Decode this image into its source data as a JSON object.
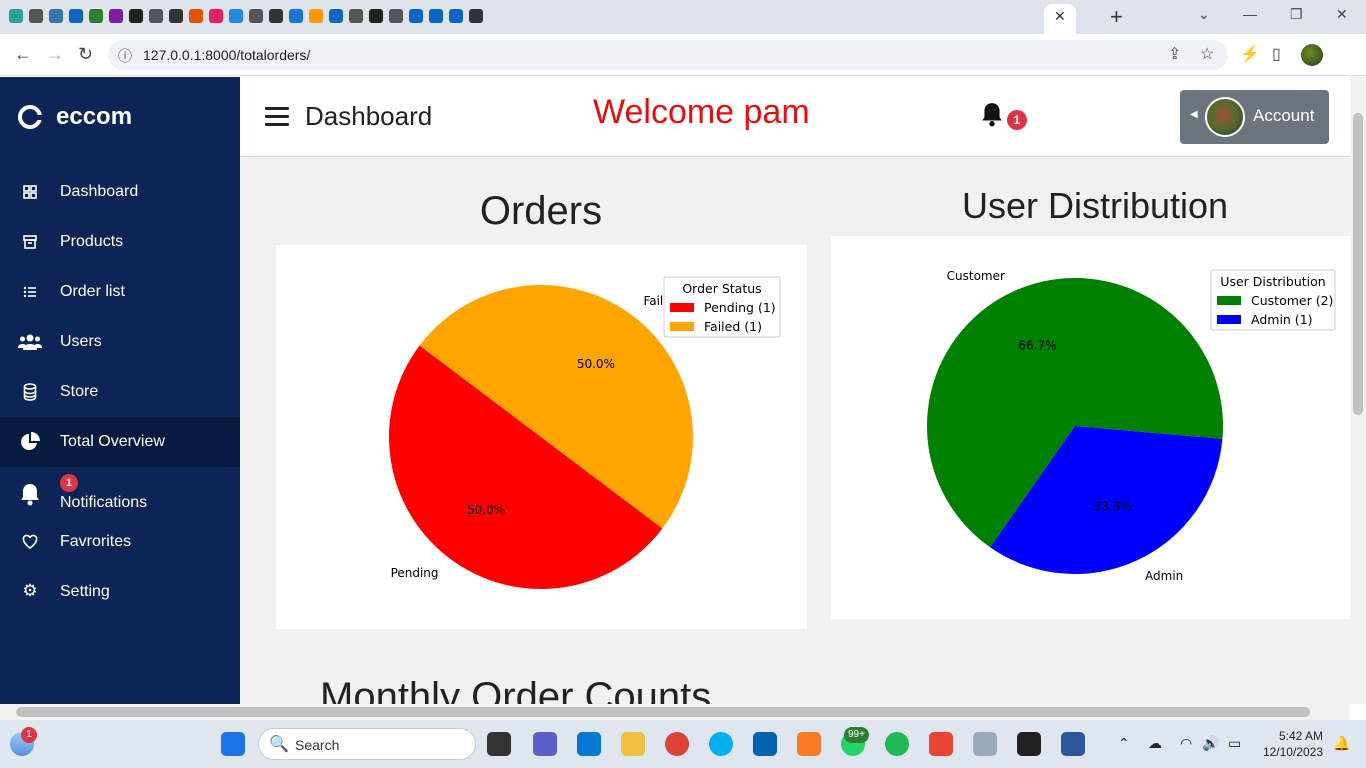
{
  "browser": {
    "url": "127.0.0.1:8000/totalorders/",
    "tab_close": "✕",
    "new_tab": "+"
  },
  "sidebar": {
    "brand": "eccom",
    "items": [
      {
        "label": "Dashboard",
        "icon": "grid-icon"
      },
      {
        "label": "Products",
        "icon": "archive-icon"
      },
      {
        "label": "Order list",
        "icon": "list-icon"
      },
      {
        "label": "Users",
        "icon": "users-icon"
      },
      {
        "label": "Store",
        "icon": "database-icon"
      },
      {
        "label": "Total Overview",
        "icon": "pie-chart-icon"
      },
      {
        "label": "Notifications",
        "icon": "bell-icon",
        "badge": "1"
      },
      {
        "label": "Favrorites",
        "icon": "heart-icon"
      },
      {
        "label": "Setting",
        "icon": "gear-icon"
      }
    ]
  },
  "header": {
    "title": "Dashboard",
    "welcome": "Welcome pam",
    "notification_count": "1",
    "account_label": "Account"
  },
  "charts": {
    "orders_title": "Orders",
    "users_title": "User Distribution",
    "monthly_title": "Monthly Order Counts"
  },
  "chart_data": [
    {
      "type": "pie",
      "title": "Orders",
      "legend_title": "Order Status",
      "legend": "top-right",
      "slices": [
        {
          "label": "Pending",
          "legend": "Pending (1)",
          "value": 1,
          "pct": "50.0%",
          "color": "#ff0000"
        },
        {
          "label": "Failed",
          "legend": "Failed (1)",
          "value": 1,
          "pct": "50.0%",
          "color": "#ffa500"
        }
      ]
    },
    {
      "type": "pie",
      "title": "User Distribution",
      "legend_title": "User Distribution",
      "legend": "top-right",
      "slices": [
        {
          "label": "Customer",
          "legend": "Customer (2)",
          "value": 2,
          "pct": "66.7%",
          "color": "#008000"
        },
        {
          "label": "Admin",
          "legend": "Admin (1)",
          "value": 1,
          "pct": "33.3%",
          "color": "#0000ff"
        }
      ]
    }
  ],
  "taskbar": {
    "search_placeholder": "Search",
    "time": "5:42 AM",
    "date": "12/10/2023",
    "weather_badge": "1",
    "whatsapp_badge": "99+"
  }
}
